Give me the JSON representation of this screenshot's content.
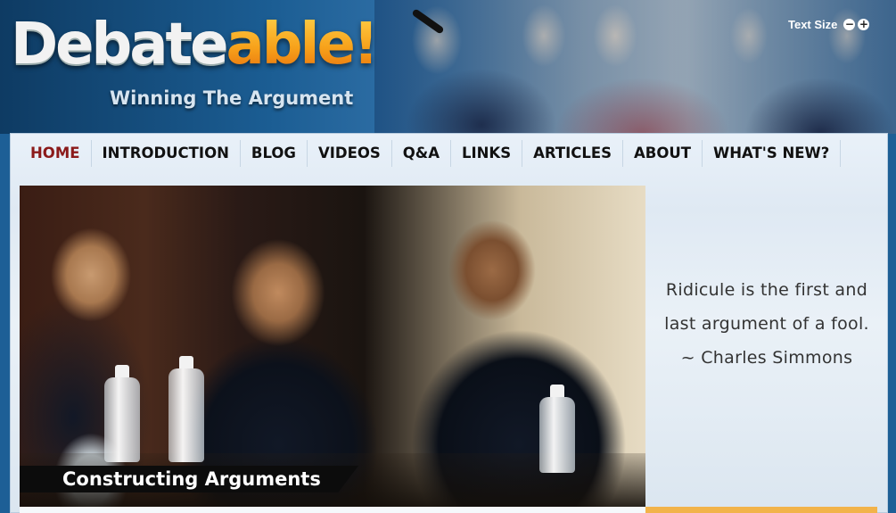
{
  "header": {
    "logo": {
      "part1": "Debate",
      "part2": "able!"
    },
    "tagline": "Winning The Argument",
    "text_size": {
      "label": "Text Size",
      "decrease_icon": "minus-circle-icon",
      "increase_icon": "plus-circle-icon",
      "decrease_glyph": "−",
      "increase_glyph": "+"
    }
  },
  "nav": {
    "items": [
      {
        "label": "HOME",
        "active": true
      },
      {
        "label": "INTRODUCTION"
      },
      {
        "label": "BLOG"
      },
      {
        "label": "VIDEOS"
      },
      {
        "label": "Q&A"
      },
      {
        "label": "LINKS"
      },
      {
        "label": "ARTICLES"
      },
      {
        "label": "ABOUT"
      },
      {
        "label": "WHAT'S NEW?"
      }
    ]
  },
  "feature": {
    "caption": "Constructing Arguments"
  },
  "quote": {
    "text": "Ridicule is the first and last argument of a fool. ~ Charles Simmons"
  },
  "colors": {
    "nav_active": "#8b1a1a",
    "logo_orange": "#f39a1e",
    "accent_line": "#f2b34a"
  }
}
